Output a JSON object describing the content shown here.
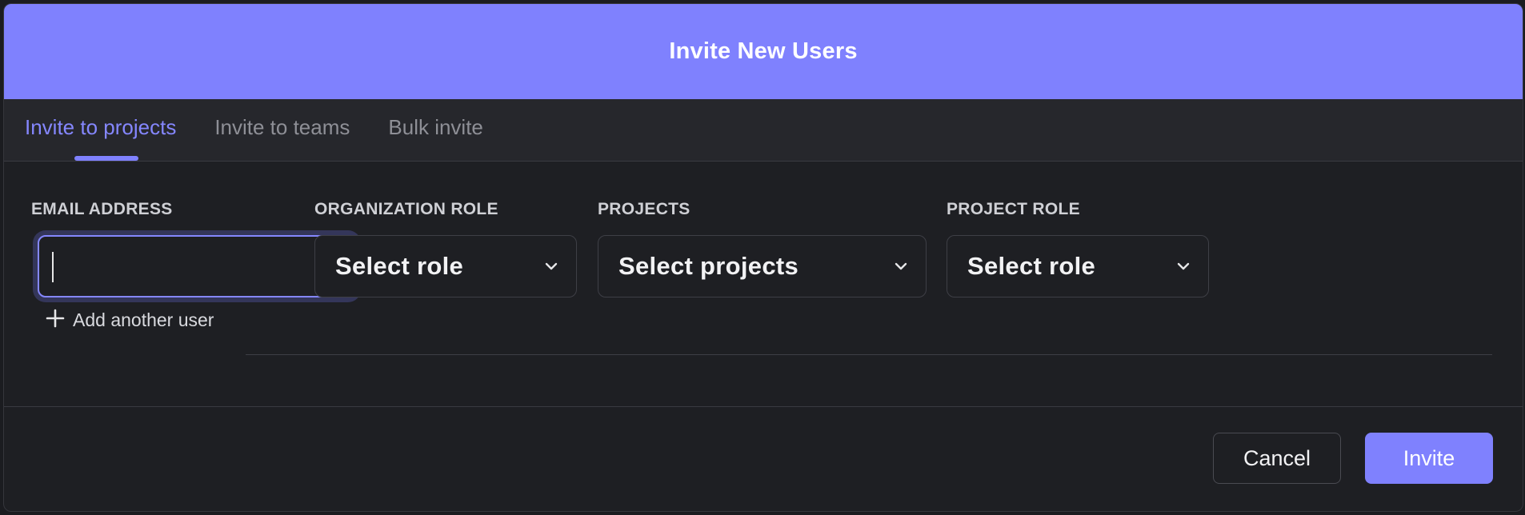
{
  "modal": {
    "title": "Invite New Users"
  },
  "tabs": [
    {
      "label": "Invite to projects",
      "active": true
    },
    {
      "label": "Invite to teams",
      "active": false
    },
    {
      "label": "Bulk invite",
      "active": false
    }
  ],
  "form": {
    "email": {
      "label": "EMAIL ADDRESS",
      "value": "",
      "placeholder": ""
    },
    "org_role": {
      "label": "ORGANIZATION ROLE",
      "value": "Select role"
    },
    "projects": {
      "label": "PROJECTS",
      "value": "Select projects"
    },
    "project_role": {
      "label": "PROJECT ROLE",
      "value": "Select role"
    },
    "add_user_label": "Add another user"
  },
  "footer": {
    "cancel_label": "Cancel",
    "invite_label": "Invite"
  },
  "colors": {
    "accent": "#7f81fe",
    "background": "#1e1f23",
    "tab_bar": "#26272c"
  },
  "icons": {
    "chevron": "chevron-down-icon",
    "plus": "plus-icon"
  }
}
